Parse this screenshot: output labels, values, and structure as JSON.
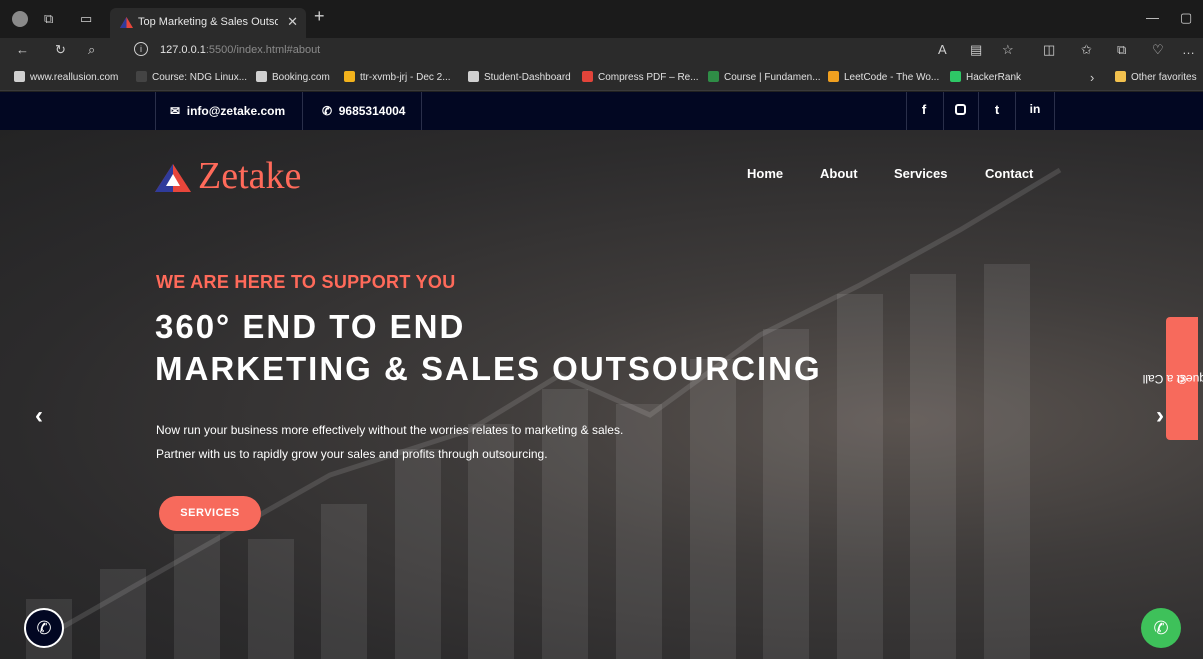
{
  "browser": {
    "tab_title": "Top Marketing & Sales Outsourc",
    "new_tab_icon": "+",
    "url_host": "127.0.0.1",
    "url_rest": ":5500/index.html#about",
    "bookmarks": [
      {
        "label": "www.reallusion.com",
        "icon_color": "#d0d0d0"
      },
      {
        "label": "Course: NDG Linux...",
        "icon_color": "#444444"
      },
      {
        "label": "Booking.com",
        "icon_color": "#d0d0d0"
      },
      {
        "label": "ttr-xvmb-jrj - Dec 2...",
        "icon_color": "#f2b21c"
      },
      {
        "label": "Student-Dashboard",
        "icon_color": "#d0d0d0"
      },
      {
        "label": "Compress PDF – Re...",
        "icon_color": "#e2443a"
      },
      {
        "label": "Course | Fundamen...",
        "icon_color": "#2f8d46"
      },
      {
        "label": "LeetCode - The Wo...",
        "icon_color": "#f0a020"
      },
      {
        "label": "HackerRank",
        "icon_color": "#2ec866"
      }
    ],
    "other_favorites": "Other favorites"
  },
  "topbar": {
    "email": "info@zetake.com",
    "phone": "9685314004",
    "social": [
      "f",
      "ig",
      "t",
      "in"
    ]
  },
  "nav": {
    "logo": "Zetake",
    "links": [
      "Home",
      "About",
      "Services",
      "Contact"
    ]
  },
  "hero": {
    "eyebrow": "WE ARE HERE TO SUPPORT YOU",
    "headline_1": "360° END TO END",
    "headline_2": "MARKETING & SALES OUTSOURCING",
    "description": "Now run your business more effectively without the worries relates to marketing & sales. Partner with us to rapidly grow your sales and profits through outsourcing.",
    "cta": "SERVICES",
    "request_call": "Request a Call"
  },
  "colors": {
    "accent": "#f76a5c",
    "topbar_bg": "#020722",
    "whatsapp": "#3ec15a"
  }
}
